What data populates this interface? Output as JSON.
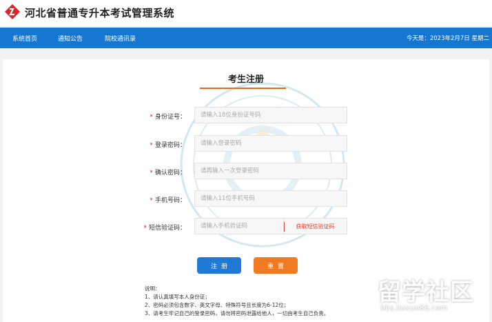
{
  "header": {
    "title": "河北省普通专升本考试管理系统"
  },
  "nav": {
    "items": [
      "系统首页",
      "通知公告",
      "院校通讯录"
    ],
    "date": "今天是：2023年2月7日 星期二"
  },
  "form": {
    "title": "考生注册",
    "rows": [
      {
        "label": "身份证号：",
        "placeholder": "请输入18位身份证号码"
      },
      {
        "label": "登录密码：",
        "placeholder": "请输入登录密码"
      },
      {
        "label": "确认密码：",
        "placeholder": "请再输入一次登录密码"
      },
      {
        "label": "手机号码：",
        "placeholder": "请输入11位手机号码"
      },
      {
        "label": "短信验证码：",
        "placeholder": "请输入手机验证码"
      }
    ],
    "required_mark": "*",
    "sms_button": "获取短信验证码",
    "register_button": "注册",
    "reset_button": "重置"
  },
  "notes": {
    "heading": "说明：",
    "lines": [
      "1、请认真填写本人身份证；",
      "2、密码必须包含数字、英文字母、特殊符号且长度为6-12位；",
      "3、请考生牢记自己的登录密码，请勿将密码泄露给他人，一切由考生自己负责。"
    ]
  },
  "watermark_badge": {
    "text": "留学社区",
    "url": "bbs.liuxue86.com"
  },
  "colors": {
    "nav": "#1677d2",
    "accent": "#e3661e",
    "register": "#1f7ad6",
    "reset": "#f07a22",
    "required": "#e02020"
  }
}
